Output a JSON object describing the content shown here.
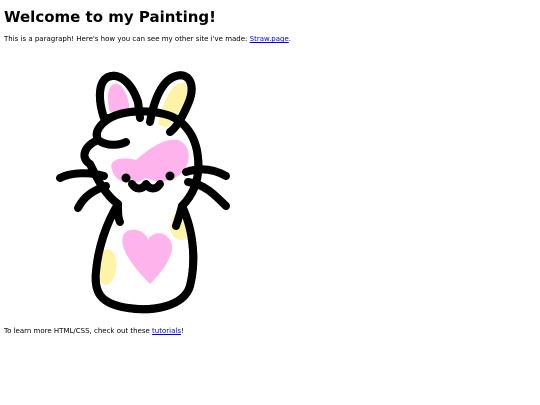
{
  "page": {
    "title": "Welcome to my Painting!",
    "intro": {
      "text_before": "This is a paragraph! Here's how you can see my other site i've made: ",
      "link_text": "Straw.page",
      "text_after": "."
    },
    "painting": {
      "subject": "bunny drawing",
      "colors": {
        "outline": "#000000",
        "pink": "#ffb3ec",
        "yellow": "#fff3a8",
        "body": "#ffffff"
      }
    },
    "outro": {
      "text_before": "To learn more HTML/CSS, check out these ",
      "link_text": "tutorials",
      "text_after": "!"
    },
    "link_color": "#0000ee"
  }
}
